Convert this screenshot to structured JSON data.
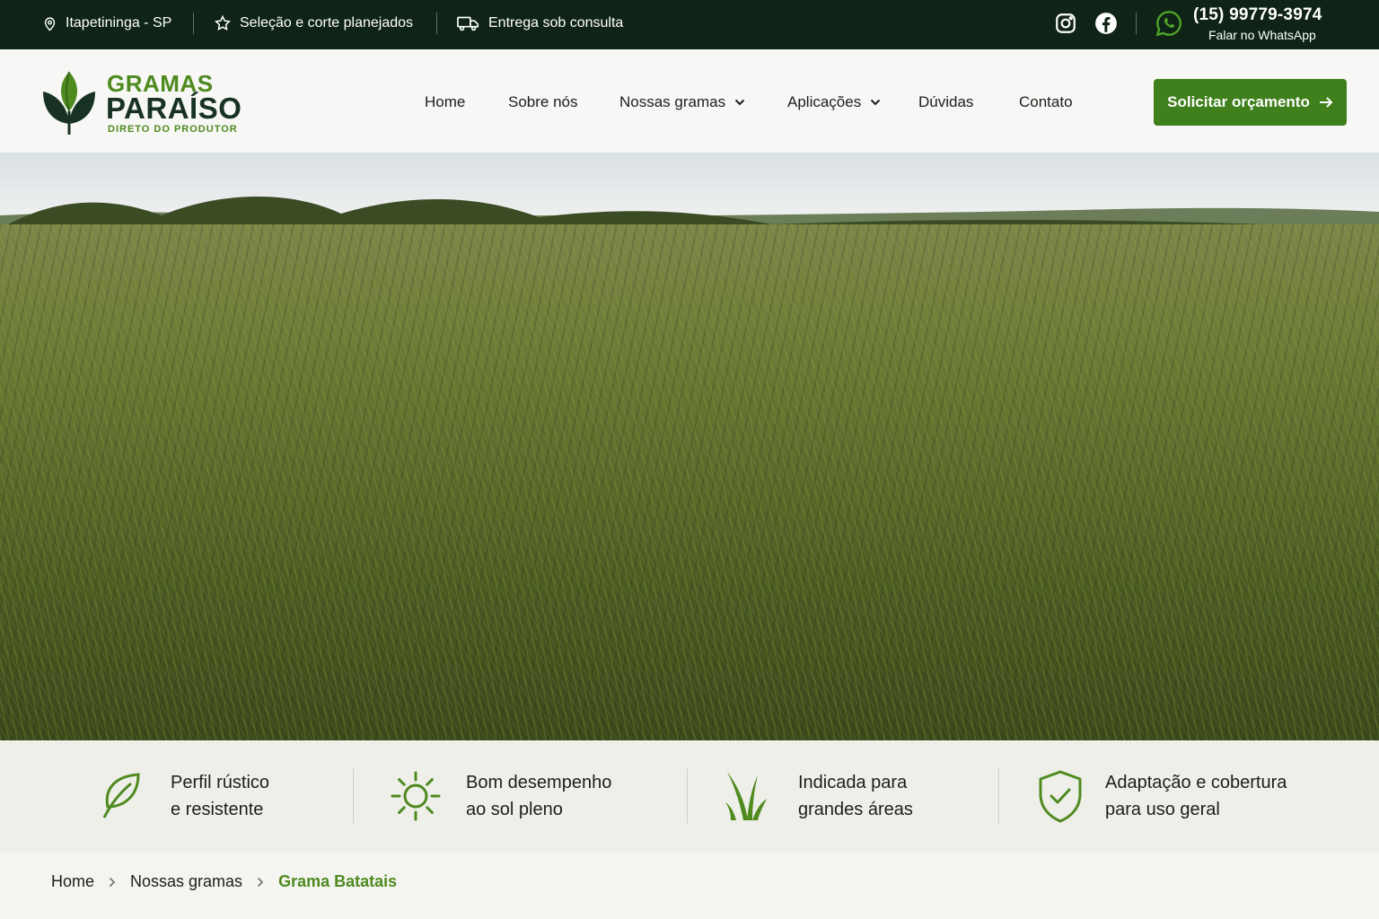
{
  "topbar": {
    "location": "Itapetininga - SP",
    "selection": "Seleção e corte planejados",
    "delivery": "Entrega sob consulta",
    "phone": "(15) 99779-3974",
    "phone_sub": "Falar no WhatsApp",
    "social_icons": [
      "instagram-icon",
      "facebook-icon",
      "whatsapp-icon"
    ]
  },
  "logo": {
    "line1": "GRAMAS",
    "line2": "PARAÍSO",
    "tagline": "DIRETO DO PRODUTOR"
  },
  "nav": {
    "items": [
      {
        "label": "Home"
      },
      {
        "label": "Sobre nós"
      },
      {
        "label": "Nossas gramas",
        "dropdown": true
      },
      {
        "label": "Aplicações",
        "dropdown": true
      },
      {
        "label": "Dúvidas"
      },
      {
        "label": "Contato"
      }
    ],
    "cta": "Solicitar orçamento"
  },
  "features": [
    {
      "icon": "leaf-icon",
      "line1": "Perfil rústico",
      "line2": "e resistente"
    },
    {
      "icon": "sun-icon",
      "line1": "Bom desempenho",
      "line2": "ao sol pleno"
    },
    {
      "icon": "grass-icon",
      "line1": "Indicada para",
      "line2": "grandes áreas"
    },
    {
      "icon": "shield-check-icon",
      "line1": "Adaptação e cobertura",
      "line2": "para uso geral"
    }
  ],
  "breadcrumb": [
    "Home",
    "Nossas gramas",
    "Grama Batatais"
  ],
  "colors": {
    "topbar_bg": "#0f2416",
    "brand_green": "#3f7f1c",
    "brand_dark": "#173222",
    "accent_green": "#4f8a1f"
  }
}
